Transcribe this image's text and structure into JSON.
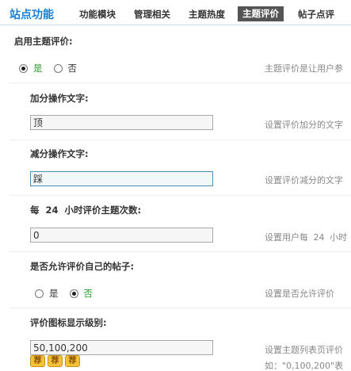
{
  "header": {
    "site_title": "站点功能",
    "tabs": [
      {
        "label": "功能模块"
      },
      {
        "label": "管理相关"
      },
      {
        "label": "主题热度"
      },
      {
        "label": "主题评价"
      },
      {
        "label": "帖子点评"
      }
    ]
  },
  "settings": {
    "enable": {
      "label": "启用主题评价:",
      "options": [
        "是",
        "否"
      ],
      "selected": "是",
      "hint": "主题评价是让用户参"
    },
    "plus_text": {
      "label": "加分操作文字:",
      "value": "顶",
      "hint": "设置评价加分的文字"
    },
    "minus_text": {
      "label": "减分操作文字:",
      "value": "踩",
      "hint": "设置评价减分的文字"
    },
    "times_per_day": {
      "label_prefix": "每",
      "label_num": "24",
      "label_suffix": "小时评价主题次数:",
      "value": "0",
      "hint_prefix": "设置用户每",
      "hint_num": "24",
      "hint_suffix": "小时"
    },
    "allow_self": {
      "label": "是否允许评价自己的帖子:",
      "options": [
        "是",
        "否"
      ],
      "selected": "否",
      "hint": "设置是否允许评价"
    },
    "icon_level": {
      "label": "评价图标显示级别:",
      "value": "50,100,200",
      "hint_line1": "设置主题列表页评价",
      "hint_line2": "如：\"0,100,200\"表",
      "icon_text": "荐",
      "icon_count": 3
    }
  },
  "colors": {
    "accent": "#1a7fd0",
    "active_tab_bg": "#555555",
    "on_green": "#2a9a2a"
  }
}
